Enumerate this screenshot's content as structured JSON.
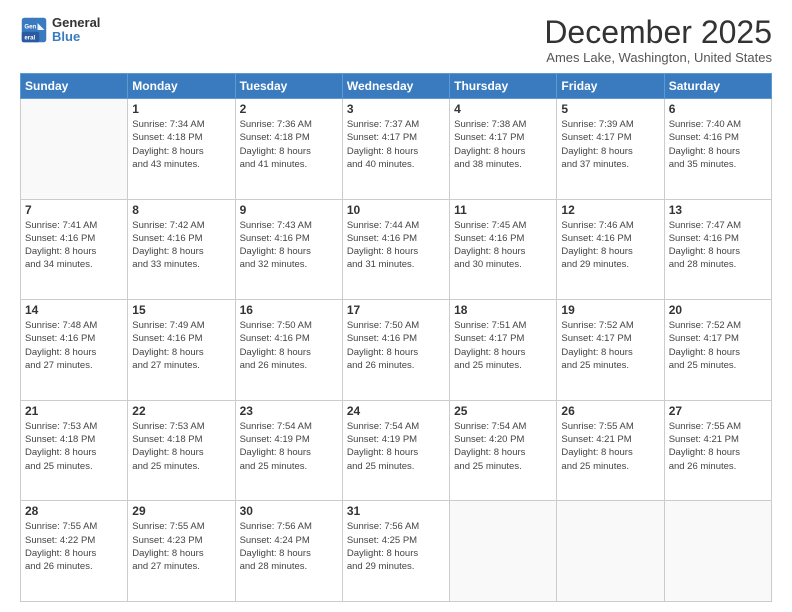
{
  "header": {
    "logo_line1": "General",
    "logo_line2": "Blue",
    "month": "December 2025",
    "location": "Ames Lake, Washington, United States"
  },
  "weekdays": [
    "Sunday",
    "Monday",
    "Tuesday",
    "Wednesday",
    "Thursday",
    "Friday",
    "Saturday"
  ],
  "weeks": [
    [
      {
        "day": "",
        "info": ""
      },
      {
        "day": "1",
        "info": "Sunrise: 7:34 AM\nSunset: 4:18 PM\nDaylight: 8 hours\nand 43 minutes."
      },
      {
        "day": "2",
        "info": "Sunrise: 7:36 AM\nSunset: 4:18 PM\nDaylight: 8 hours\nand 41 minutes."
      },
      {
        "day": "3",
        "info": "Sunrise: 7:37 AM\nSunset: 4:17 PM\nDaylight: 8 hours\nand 40 minutes."
      },
      {
        "day": "4",
        "info": "Sunrise: 7:38 AM\nSunset: 4:17 PM\nDaylight: 8 hours\nand 38 minutes."
      },
      {
        "day": "5",
        "info": "Sunrise: 7:39 AM\nSunset: 4:17 PM\nDaylight: 8 hours\nand 37 minutes."
      },
      {
        "day": "6",
        "info": "Sunrise: 7:40 AM\nSunset: 4:16 PM\nDaylight: 8 hours\nand 35 minutes."
      }
    ],
    [
      {
        "day": "7",
        "info": "Sunrise: 7:41 AM\nSunset: 4:16 PM\nDaylight: 8 hours\nand 34 minutes."
      },
      {
        "day": "8",
        "info": "Sunrise: 7:42 AM\nSunset: 4:16 PM\nDaylight: 8 hours\nand 33 minutes."
      },
      {
        "day": "9",
        "info": "Sunrise: 7:43 AM\nSunset: 4:16 PM\nDaylight: 8 hours\nand 32 minutes."
      },
      {
        "day": "10",
        "info": "Sunrise: 7:44 AM\nSunset: 4:16 PM\nDaylight: 8 hours\nand 31 minutes."
      },
      {
        "day": "11",
        "info": "Sunrise: 7:45 AM\nSunset: 4:16 PM\nDaylight: 8 hours\nand 30 minutes."
      },
      {
        "day": "12",
        "info": "Sunrise: 7:46 AM\nSunset: 4:16 PM\nDaylight: 8 hours\nand 29 minutes."
      },
      {
        "day": "13",
        "info": "Sunrise: 7:47 AM\nSunset: 4:16 PM\nDaylight: 8 hours\nand 28 minutes."
      }
    ],
    [
      {
        "day": "14",
        "info": "Sunrise: 7:48 AM\nSunset: 4:16 PM\nDaylight: 8 hours\nand 27 minutes."
      },
      {
        "day": "15",
        "info": "Sunrise: 7:49 AM\nSunset: 4:16 PM\nDaylight: 8 hours\nand 27 minutes."
      },
      {
        "day": "16",
        "info": "Sunrise: 7:50 AM\nSunset: 4:16 PM\nDaylight: 8 hours\nand 26 minutes."
      },
      {
        "day": "17",
        "info": "Sunrise: 7:50 AM\nSunset: 4:16 PM\nDaylight: 8 hours\nand 26 minutes."
      },
      {
        "day": "18",
        "info": "Sunrise: 7:51 AM\nSunset: 4:17 PM\nDaylight: 8 hours\nand 25 minutes."
      },
      {
        "day": "19",
        "info": "Sunrise: 7:52 AM\nSunset: 4:17 PM\nDaylight: 8 hours\nand 25 minutes."
      },
      {
        "day": "20",
        "info": "Sunrise: 7:52 AM\nSunset: 4:17 PM\nDaylight: 8 hours\nand 25 minutes."
      }
    ],
    [
      {
        "day": "21",
        "info": "Sunrise: 7:53 AM\nSunset: 4:18 PM\nDaylight: 8 hours\nand 25 minutes."
      },
      {
        "day": "22",
        "info": "Sunrise: 7:53 AM\nSunset: 4:18 PM\nDaylight: 8 hours\nand 25 minutes."
      },
      {
        "day": "23",
        "info": "Sunrise: 7:54 AM\nSunset: 4:19 PM\nDaylight: 8 hours\nand 25 minutes."
      },
      {
        "day": "24",
        "info": "Sunrise: 7:54 AM\nSunset: 4:19 PM\nDaylight: 8 hours\nand 25 minutes."
      },
      {
        "day": "25",
        "info": "Sunrise: 7:54 AM\nSunset: 4:20 PM\nDaylight: 8 hours\nand 25 minutes."
      },
      {
        "day": "26",
        "info": "Sunrise: 7:55 AM\nSunset: 4:21 PM\nDaylight: 8 hours\nand 25 minutes."
      },
      {
        "day": "27",
        "info": "Sunrise: 7:55 AM\nSunset: 4:21 PM\nDaylight: 8 hours\nand 26 minutes."
      }
    ],
    [
      {
        "day": "28",
        "info": "Sunrise: 7:55 AM\nSunset: 4:22 PM\nDaylight: 8 hours\nand 26 minutes."
      },
      {
        "day": "29",
        "info": "Sunrise: 7:55 AM\nSunset: 4:23 PM\nDaylight: 8 hours\nand 27 minutes."
      },
      {
        "day": "30",
        "info": "Sunrise: 7:56 AM\nSunset: 4:24 PM\nDaylight: 8 hours\nand 28 minutes."
      },
      {
        "day": "31",
        "info": "Sunrise: 7:56 AM\nSunset: 4:25 PM\nDaylight: 8 hours\nand 29 minutes."
      },
      {
        "day": "",
        "info": ""
      },
      {
        "day": "",
        "info": ""
      },
      {
        "day": "",
        "info": ""
      }
    ]
  ]
}
